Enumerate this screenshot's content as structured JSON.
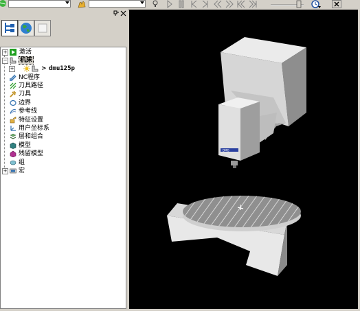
{
  "toolbar": {
    "combo1_value": "",
    "combo2_value": "",
    "icons": [
      "green-circle-icon",
      "dropdown-icon",
      "hand-tool-icon",
      "lightbulb-icon",
      "play-icon",
      "pause-icon",
      "step-back-icon",
      "step-forward-icon",
      "rewind-icon",
      "fast-forward-icon",
      "to-start-icon",
      "to-end-icon",
      "slider-icon",
      "clock-icon",
      "close-icon"
    ]
  },
  "panel": {
    "header_buttons": [
      "pin",
      "close"
    ],
    "tabs": [
      "explorer-tab",
      "globe-tab",
      "blank-tab"
    ]
  },
  "tree": {
    "items": [
      {
        "label": "激活",
        "icon": "activate-icon"
      },
      {
        "label": "机床",
        "icon": "machine-icon"
      },
      {
        "label": "dmu125p",
        "icon": "machine-model-icon"
      },
      {
        "label": "NC程序",
        "icon": "nc-program-icon"
      },
      {
        "label": "刀具路径",
        "icon": "toolpath-icon"
      },
      {
        "label": "刀具",
        "icon": "tool-icon"
      },
      {
        "label": "边界",
        "icon": "boundary-icon"
      },
      {
        "label": "参考线",
        "icon": "reference-line-icon"
      },
      {
        "label": "特征设置",
        "icon": "feature-set-icon"
      },
      {
        "label": "用户坐标系",
        "icon": "workplane-icon"
      },
      {
        "label": "层和组合",
        "icon": "layers-icon"
      },
      {
        "label": "模型",
        "icon": "model-icon"
      },
      {
        "label": "残留模型",
        "icon": "stock-model-icon"
      },
      {
        "label": "组",
        "icon": "group-icon"
      },
      {
        "label": "宏",
        "icon": "macro-icon"
      }
    ]
  },
  "viewport": {
    "spindle_brand": "DMG",
    "background": "#000000"
  },
  "colors": {
    "face": "#d4d0c8",
    "machine_light": "#e6e6e6",
    "machine_mid": "#c8c8c8",
    "machine_dark": "#9a9a9a",
    "table_top": "#8a8a8a"
  }
}
